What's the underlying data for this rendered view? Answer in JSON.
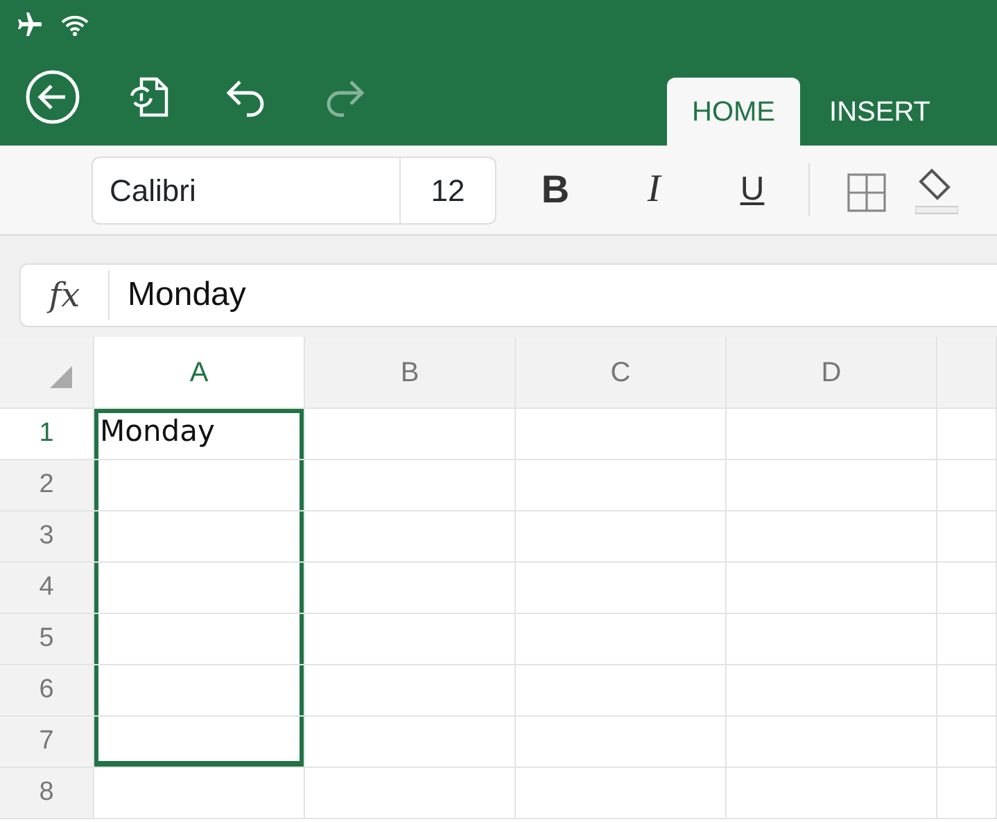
{
  "toolbar": [
    {
      "kind": "back",
      "disabled": false
    },
    {
      "kind": "sync",
      "disabled": false
    },
    {
      "kind": "undo",
      "disabled": false
    },
    {
      "kind": "redo",
      "disabled": true
    }
  ],
  "tabs": [
    {
      "label": "HOME",
      "selected": true
    },
    {
      "label": "INSERT",
      "selected": false
    }
  ],
  "ribbon": {
    "font": "Calibri",
    "size": "12",
    "buttons": [
      {
        "kind": "bold",
        "label": "B"
      },
      {
        "kind": "italic",
        "label": "I"
      },
      {
        "kind": "underline",
        "label": "U"
      },
      {
        "kind": "borders"
      },
      {
        "kind": "fill"
      }
    ]
  },
  "formula_bar": {
    "label": "fx",
    "value": "Monday"
  },
  "columns": [
    {
      "label": "A",
      "selected": true
    },
    {
      "label": "B",
      "selected": false
    },
    {
      "label": "C",
      "selected": false
    },
    {
      "label": "D",
      "selected": false
    }
  ],
  "rows": [
    {
      "label": "1",
      "active": true,
      "selected": true,
      "cells": [
        "Monday"
      ]
    },
    {
      "label": "2",
      "active": false,
      "selected": true
    },
    {
      "label": "3",
      "active": false,
      "selected": true
    },
    {
      "label": "4",
      "active": false,
      "selected": true
    },
    {
      "label": "5",
      "active": false,
      "selected": true
    },
    {
      "label": "6",
      "active": false,
      "selected": true
    },
    {
      "label": "7",
      "active": false,
      "selected": true
    },
    {
      "label": "8",
      "active": false,
      "selected": false
    }
  ]
}
